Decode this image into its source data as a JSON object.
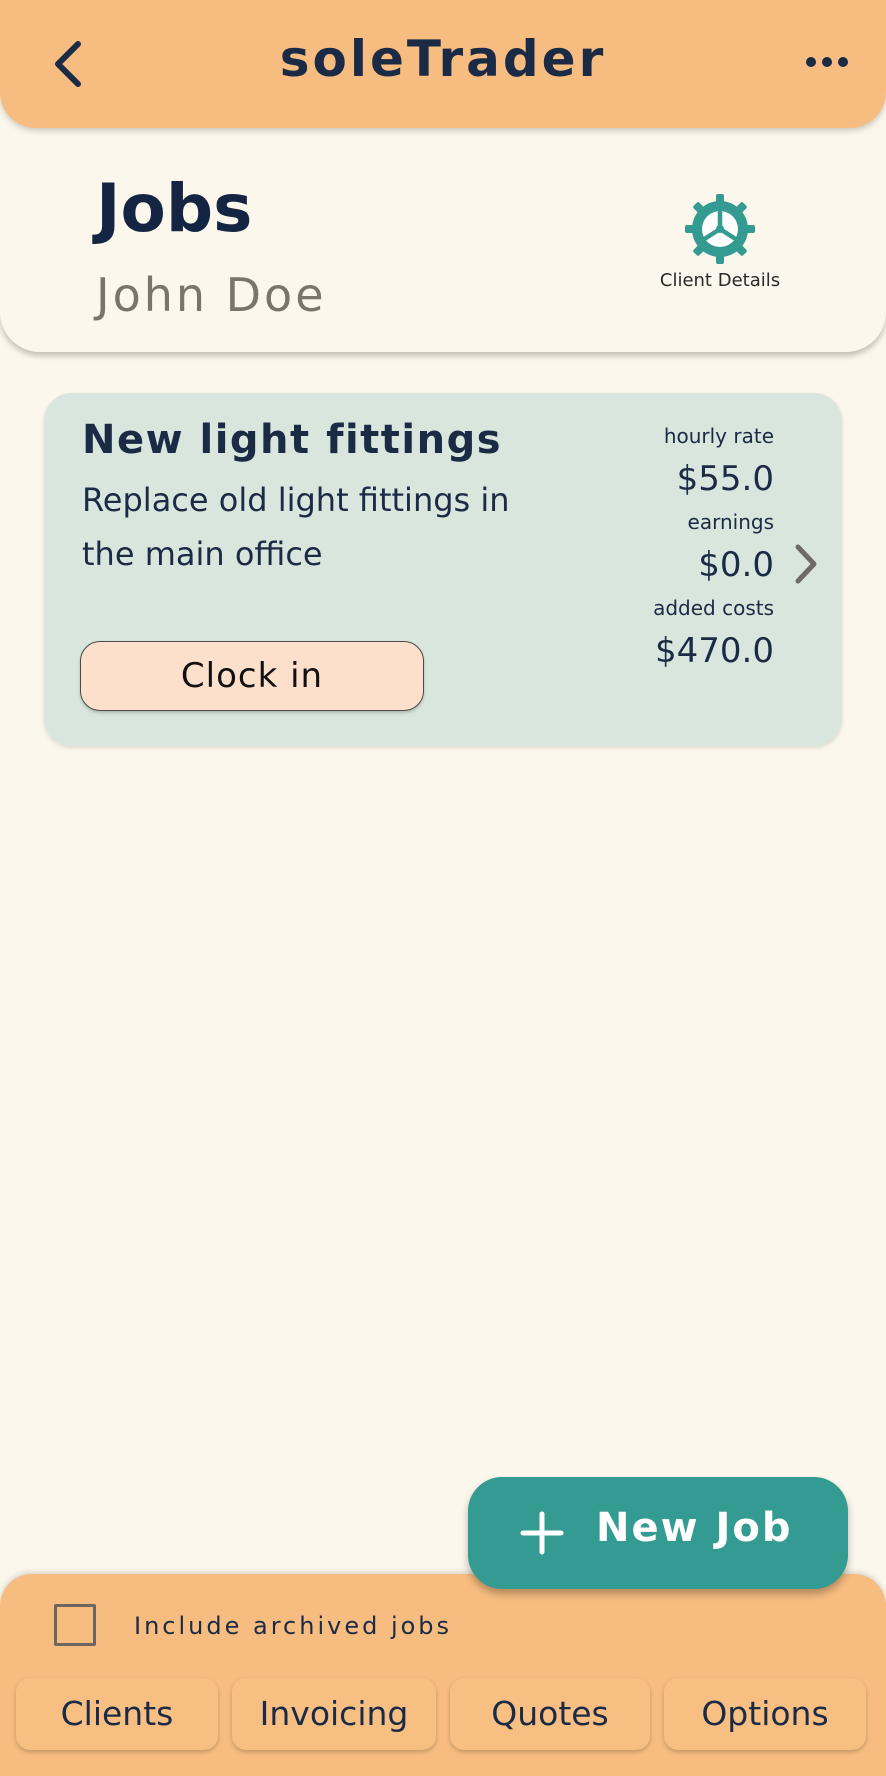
{
  "app": {
    "title": "soleTrader"
  },
  "header": {
    "title": "Jobs",
    "client_name": "John Doe",
    "client_details_label": "Client Details"
  },
  "jobs": [
    {
      "title": "New light fittings",
      "description": "Replace old light fittings in the main office",
      "clock_button": "Clock  in",
      "hourly_rate_label": "hourly rate",
      "hourly_rate": "$55.0",
      "earnings_label": "earnings",
      "earnings": "$0.0",
      "added_costs_label": "added costs",
      "added_costs": "$470.0"
    }
  ],
  "fab": {
    "label": "New Job"
  },
  "footer": {
    "archive_checkbox_label": "Include archived jobs",
    "archive_checked": false,
    "nav": [
      "Clients",
      "Invoicing",
      "Quotes",
      "Options"
    ]
  },
  "colors": {
    "topbar": "#f7bd80",
    "background": "#fcf7ec",
    "card": "#d9e6dd",
    "accent_teal": "#339b92",
    "text_primary": "#1b2a45"
  },
  "icons": {
    "back": "chevron-left-icon",
    "more": "more-horizontal-icon",
    "client_details": "gear-icon",
    "job_open": "chevron-right-icon",
    "fab": "plus-icon"
  }
}
